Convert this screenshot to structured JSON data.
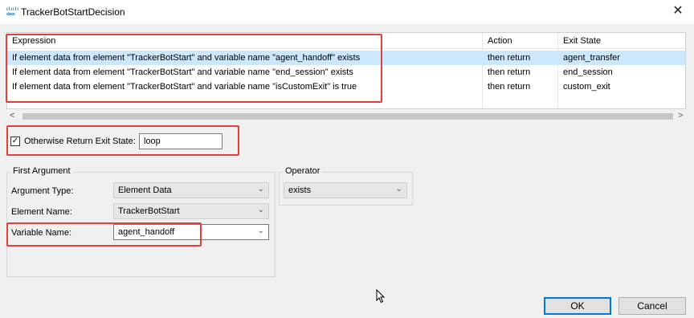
{
  "window": {
    "app_icon_text": "cisco",
    "title": "TrackerBotStartDecision",
    "close_glyph": "✕"
  },
  "table": {
    "columns": [
      "Expression",
      "Action",
      "Exit State"
    ],
    "rows": [
      {
        "expression": "If element data from element \"TrackerBotStart\" and variable name \"agent_handoff\" exists",
        "action": "then return",
        "exit_state": "agent_transfer",
        "selected": true
      },
      {
        "expression": "If element data from element \"TrackerBotStart\" and variable name \"end_session\" exists",
        "action": "then return",
        "exit_state": "end_session",
        "selected": false
      },
      {
        "expression": "If element data from element \"TrackerBotStart\" and variable name \"isCustomExit\" is true",
        "action": "then return",
        "exit_state": "custom_exit",
        "selected": false
      }
    ],
    "scroll_left_glyph": "<",
    "scroll_right_glyph": ">"
  },
  "otherwise": {
    "checked": true,
    "check_glyph": "✓",
    "label": "Otherwise Return Exit State:",
    "value": "loop"
  },
  "first_argument": {
    "title": "First Argument",
    "argument_type_label": "Argument Type:",
    "argument_type_value": "Element Data",
    "element_name_label": "Element Name:",
    "element_name_value": "TrackerBotStart",
    "variable_name_label": "Variable Name:",
    "variable_name_value": "agent_handoff"
  },
  "operator": {
    "title": "Operator",
    "value": "exists"
  },
  "buttons": {
    "ok": "OK",
    "cancel": "Cancel"
  },
  "colors": {
    "highlight_box": "#e0413d",
    "selected_row": "#cce8ff",
    "default_button_border": "#0078d7"
  },
  "icons": {
    "chevron": "chevron-down-icon",
    "cursor": "mouse-pointer-icon"
  }
}
